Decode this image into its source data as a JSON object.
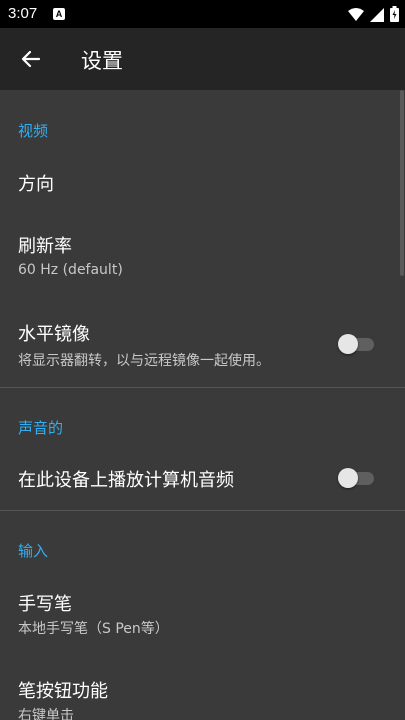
{
  "status": {
    "time": "3:07",
    "notif_letter": "A"
  },
  "app_bar": {
    "title": "设置"
  },
  "sections": {
    "video": {
      "header": "视频",
      "orientation": {
        "title": "方向"
      },
      "refresh_rate": {
        "title": "刷新率",
        "value": "60 Hz (default)"
      },
      "mirror": {
        "title": "水平镜像",
        "description": "将显示器翻转，以与远程镜像一起使用。",
        "enabled": false
      }
    },
    "sound": {
      "header": "声音的",
      "play_on_device": {
        "title": "在此设备上播放计算机音频",
        "enabled": false
      }
    },
    "input": {
      "header": "输入",
      "stylus": {
        "title": "手写笔",
        "value": "本地手写笔（S Pen等）"
      },
      "pen_button": {
        "title": "笔按钮功能",
        "value": "右键单击"
      }
    }
  },
  "colors": {
    "accent": "#33aef0",
    "background": "#3a3a3a",
    "app_bar": "#252525"
  }
}
